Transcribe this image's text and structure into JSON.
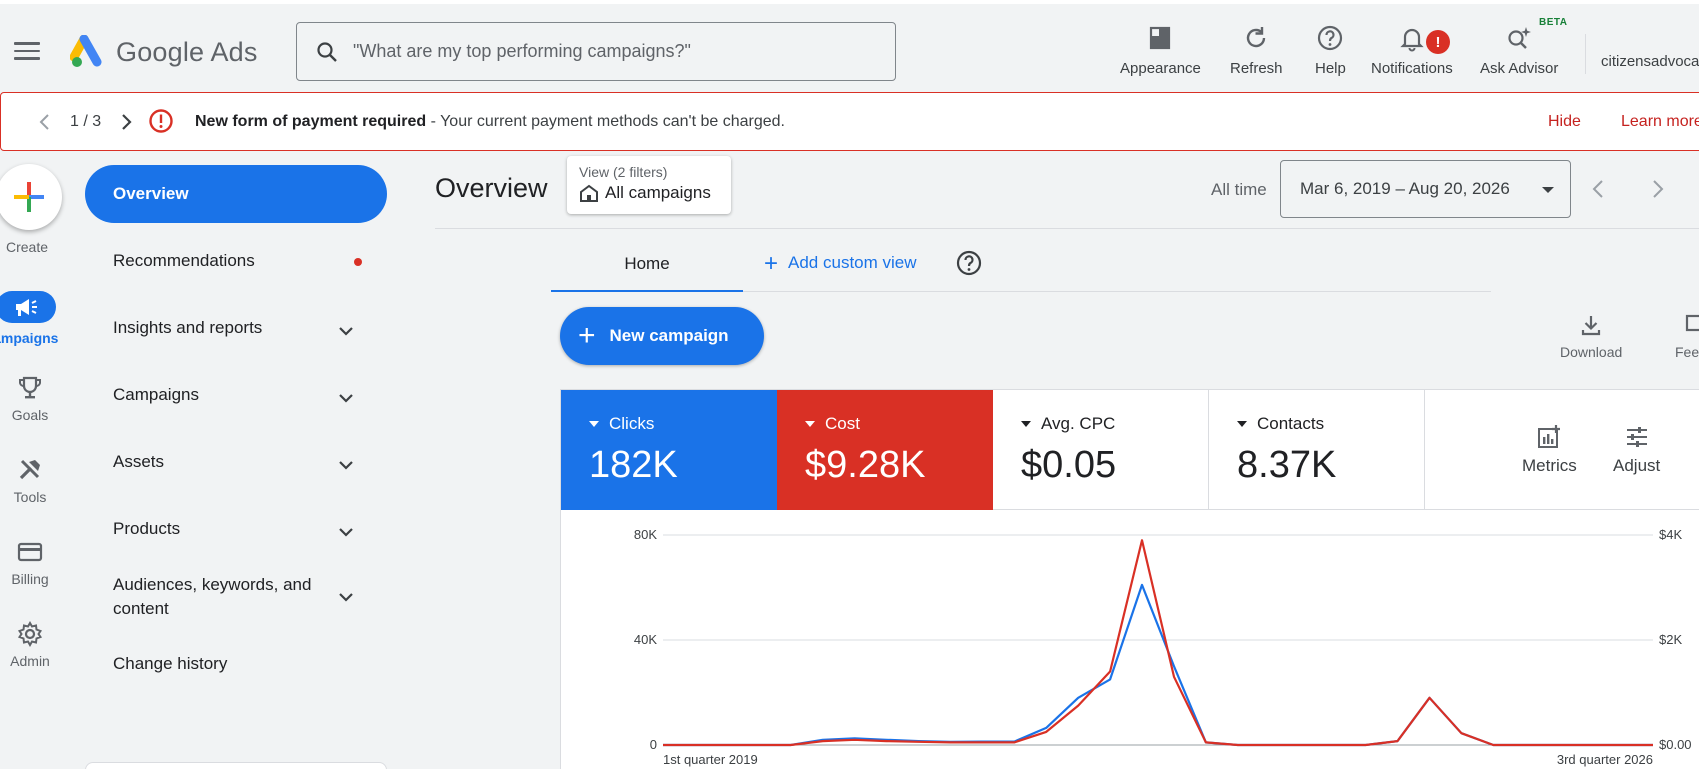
{
  "app": {
    "logo_text": "Google Ads",
    "search_placeholder": "\"What are my top performing campaigns?\""
  },
  "toolbar": {
    "appearance": "Appearance",
    "refresh": "Refresh",
    "help": "Help",
    "notifications": "Notifications",
    "notifications_badge": "!",
    "ask_advisor": "Ask Advisor",
    "beta": "BETA",
    "account": "citizensadvoca"
  },
  "alert": {
    "counter": "1 / 3",
    "title": "New form of payment required",
    "message": " - Your current payment methods can't be charged.",
    "hide": "Hide",
    "learn_more": "Learn more"
  },
  "rail": {
    "create": "Create",
    "campaigns": "Campaigns",
    "goals": "Goals",
    "tools": "Tools",
    "billing": "Billing",
    "admin": "Admin"
  },
  "nav": {
    "overview": "Overview",
    "recommendations": "Recommendations",
    "insights": "Insights and reports",
    "campaigns": "Campaigns",
    "assets": "Assets",
    "products": "Products",
    "audiences_line1": "Audiences, keywords, and",
    "audiences_line2": "content",
    "change_history": "Change history"
  },
  "header": {
    "title": "Overview",
    "view_small": "View (2 filters)",
    "view_big": "All campaigns",
    "all_time": "All time",
    "date_range": "Mar 6, 2019 – Aug 20, 2026"
  },
  "tabs": {
    "home": "Home",
    "add_custom_view": "Add custom view"
  },
  "actions": {
    "new_campaign": "New campaign",
    "download": "Download",
    "feedback": "Feedback"
  },
  "scorecards": [
    {
      "label": "Clicks",
      "value": "182K"
    },
    {
      "label": "Cost",
      "value": "$9.28K"
    },
    {
      "label": "Avg. CPC",
      "value": "$0.05"
    },
    {
      "label": "Contacts",
      "value": "8.37K"
    }
  ],
  "card_tools": {
    "metrics": "Metrics",
    "adjust": "Adjust"
  },
  "colors": {
    "accent": "#1a73e8",
    "alert": "#d93025"
  },
  "chart_data": {
    "type": "line",
    "x_start_label": "1st quarter 2019",
    "x_end_label": "3rd quarter 2026",
    "y_left_ticks": [
      "0",
      "40K",
      "80K"
    ],
    "y_right_ticks": [
      "$0.00",
      "$2K",
      "$4K"
    ],
    "y_left_lim": [
      0,
      80000
    ],
    "y_right_lim": [
      0,
      4000
    ],
    "grid": true,
    "series": [
      {
        "name": "Clicks",
        "color": "#1a73e8",
        "axis": "left",
        "values": [
          0,
          0,
          0,
          0,
          0,
          2000,
          2500,
          2000,
          1500,
          1200,
          1300,
          1300,
          6500,
          18000,
          25000,
          61000,
          30000,
          1000,
          0,
          0,
          0,
          0,
          0,
          1500,
          18000,
          4500,
          0,
          0,
          0,
          0,
          0,
          0
        ]
      },
      {
        "name": "Cost",
        "color": "#d93025",
        "axis": "right",
        "values": [
          0,
          0,
          0,
          0,
          0,
          75,
          100,
          75,
          60,
          50,
          50,
          50,
          250,
          750,
          1400,
          3900,
          1300,
          50,
          0,
          0,
          0,
          0,
          0,
          75,
          900,
          225,
          0,
          0,
          0,
          0,
          0,
          0
        ]
      }
    ]
  }
}
